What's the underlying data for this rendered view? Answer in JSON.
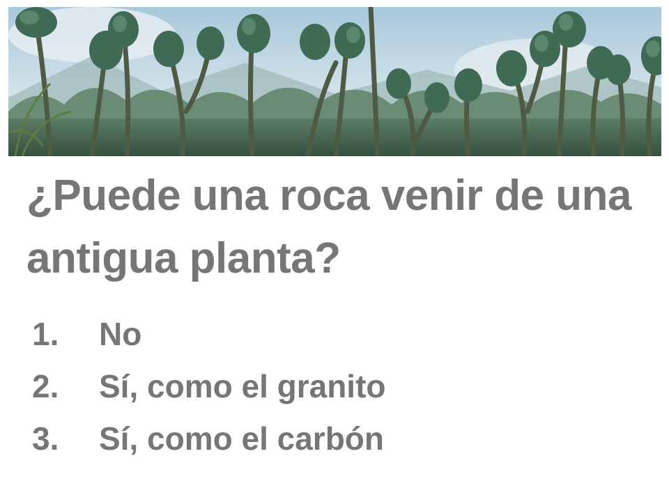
{
  "slide": {
    "banner": {
      "image": "prehistoric-forest-banner",
      "sky_color": "#bcd4e2",
      "forest_color": "#4d6e58"
    },
    "question": "¿Puede una roca venir de una antigua planta?",
    "options": [
      {
        "number": "1.",
        "text": "No"
      },
      {
        "number": "2.",
        "text": "Sí, como el granito"
      },
      {
        "number": "3.",
        "text": "Sí, como el carbón"
      }
    ],
    "text_color": "#767676"
  }
}
